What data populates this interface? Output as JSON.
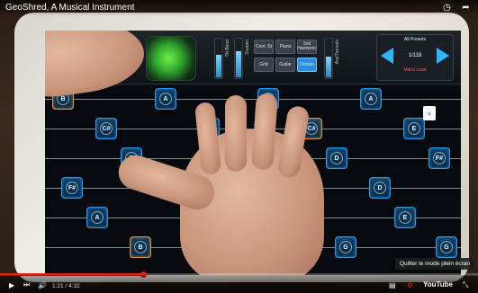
{
  "video": {
    "title": "GeoShred, A Musical Instrument",
    "time_current": "1:21",
    "time_total": "4:32",
    "time_separator": " / ",
    "progress": 0.3,
    "fullscreen_tooltip": "Quitter le mode plein écran",
    "logo_text": "YouTube"
  },
  "app": {
    "presets_title": "All Presets",
    "preset_counter": "1/118",
    "preset_name": "Mario Lead",
    "mode_buttons": [
      "Cont. St",
      "Piano",
      "2nd Harmonic",
      "Grid",
      "Guitar",
      "Octave"
    ],
    "slider_labels": [
      "Tilt Bend",
      "Sustain",
      "Arp/Tremolo"
    ],
    "slider_levels": [
      0.6,
      0.7,
      0.55
    ],
    "accent_color": "#2bb7ff",
    "preset_name_color": "#ff5a5a"
  },
  "grid": {
    "notes": [
      {
        "label": "C#",
        "gold": true
      },
      {
        "label": "D",
        "gold": false
      },
      {
        "label": "E",
        "gold": false
      },
      {
        "label": "F#",
        "gold": false
      },
      {
        "label": "A",
        "gold": false
      },
      {
        "label": "B",
        "gold": true
      },
      {
        "label": "A",
        "gold": false
      },
      {
        "label": "B",
        "gold": false
      },
      {
        "label": "F#",
        "gold": false
      },
      {
        "label": "G",
        "gold": false
      },
      {
        "label": "E",
        "gold": false
      },
      {
        "label": "D",
        "gold": false
      },
      {
        "label": "E",
        "gold": false
      },
      {
        "label": "C#",
        "gold": true
      },
      {
        "label": "D",
        "gold": false
      },
      {
        "label": "A",
        "gold": false
      },
      {
        "label": "B",
        "gold": false
      },
      {
        "label": "G",
        "gold": false
      },
      {
        "label": "A",
        "gold": false
      },
      {
        "label": "E",
        "gold": false
      },
      {
        "label": "F#",
        "gold": false
      },
      {
        "label": "D",
        "gold": false
      },
      {
        "label": "E",
        "gold": false
      },
      {
        "label": "G",
        "gold": false
      },
      {
        "label": "B",
        "gold": true
      },
      {
        "label": "C#",
        "gold": false
      }
    ]
  }
}
